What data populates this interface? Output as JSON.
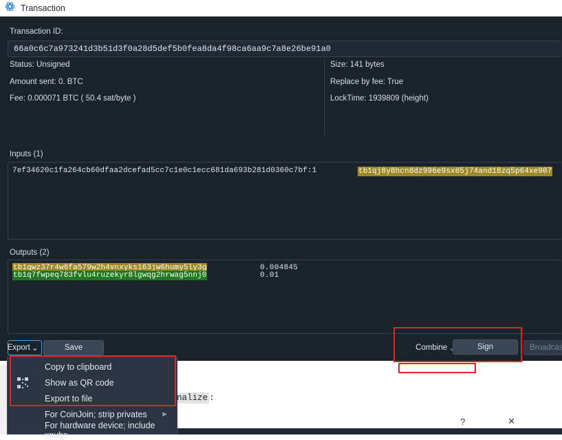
{
  "window": {
    "title": "Transaction",
    "icon": "atom-icon"
  },
  "details": {
    "txid_label": "Transaction ID:",
    "txid_value": "66a0c6c7a973241d3b51d3f0a28d5def5b0fea8da4f98ca6aa9c7a8e26be91a0",
    "left_column": [
      "Status: Unsigned",
      "Amount sent: 0. BTC",
      "Fee: 0.000071 BTC  ( 50.4 sat/byte )"
    ],
    "right_column": [
      "Size: 141 bytes",
      "Replace by fee: True",
      "LockTime: 1939809 (height)"
    ]
  },
  "inputs": {
    "label": "Inputs (1)",
    "rows": [
      {
        "outpoint": "7ef34620c1fa264cb60dfaa2dcefad5cc7c1e0c1ecc681da693b281d0360c7bf:1",
        "address": "tb1qj8y8hcn8dz996e9sx05j74and18zq5p64xe907",
        "highlight": "#9d8a26"
      }
    ]
  },
  "outputs": {
    "label": "Outputs (2)",
    "rows": [
      {
        "address": "tb1qwz37r4w6fa579w2h4vnxyks163jw6humy5ly3g",
        "amount": "0.004845",
        "highlight": "#9d8a26"
      },
      {
        "address": "tb1q7fwpeq783fvlu4ruzekyr8lgwqg2hrwag5nnj0",
        "amount": "0.01",
        "highlight": "#1f7a1f"
      }
    ]
  },
  "buttons": {
    "export": "Export",
    "export_caret": "⌄",
    "save": "Save",
    "combine": "Combine",
    "combine_caret": "⌄",
    "sign": "Sign",
    "broadcast": "Broadcas"
  },
  "context_menu": {
    "items": [
      {
        "label": "Copy to clipboard",
        "icon": "",
        "submenu": ""
      },
      {
        "label": "Show as QR code",
        "icon": "qr-code-icon",
        "submenu": ""
      },
      {
        "label": "Export to file",
        "icon": "",
        "submenu": ""
      },
      {
        "label": "For CoinJoin; strip privates",
        "icon": "",
        "submenu": "▶"
      },
      {
        "label": "For hardware device; include xpubs",
        "icon": "",
        "submenu": ""
      }
    ]
  },
  "background_window": {
    "finalize_text": "finalize",
    "finalize_suffix": ":",
    "help_button": "?",
    "close_button": "✕"
  },
  "colors": {
    "dialog_bg": "#1a222c",
    "field_bg": "#202a36",
    "accent_focus": "#4f9bdc",
    "annotation_red": "#f01e1e",
    "highlight_olive": "#9d8a26",
    "highlight_green": "#1f7a1f"
  }
}
